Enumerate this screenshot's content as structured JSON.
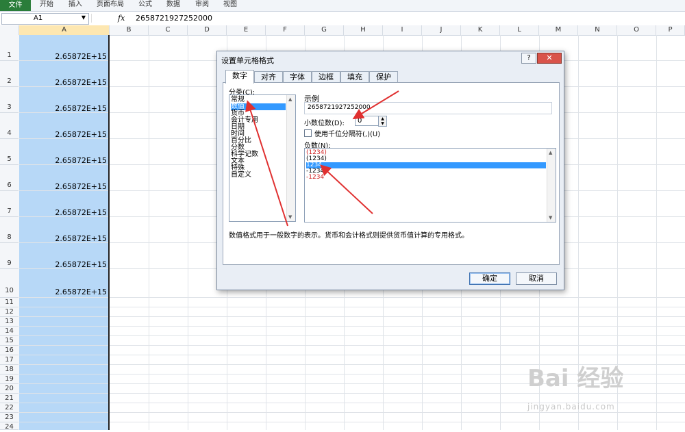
{
  "ribbon": {
    "file_tab": "文件",
    "tabs": [
      "开始",
      "插入",
      "页面布局",
      "公式",
      "数据",
      "审阅",
      "视图"
    ]
  },
  "formula_bar": {
    "name_box": "A1",
    "fx": "fx",
    "value": "2658721927252000"
  },
  "grid": {
    "columns": [
      "A",
      "B",
      "C",
      "D",
      "E",
      "F",
      "G",
      "H",
      "I",
      "J",
      "K",
      "L",
      "M",
      "N",
      "O",
      "P"
    ],
    "rows": [
      "1",
      "2",
      "3",
      "4",
      "5",
      "6",
      "7",
      "8",
      "9",
      "10",
      "11",
      "12",
      "13",
      "14",
      "15",
      "16",
      "17",
      "18",
      "19",
      "20",
      "21",
      "22",
      "23",
      "24"
    ],
    "col_a_values": [
      "2.65872E+15",
      "2.65872E+15",
      "2.65872E+15",
      "2.65872E+15",
      "2.65872E+15",
      "2.65872E+15",
      "2.65872E+15",
      "2.65872E+15",
      "2.65872E+15",
      "2.65872E+15"
    ]
  },
  "dialog": {
    "title": "设置单元格格式",
    "help": "?",
    "close": "✕",
    "tabs": [
      "数字",
      "对齐",
      "字体",
      "边框",
      "填充",
      "保护"
    ],
    "active_tab": "数字",
    "category_label": "分类(C):",
    "categories": [
      "常规",
      "数值",
      "货币",
      "会计专用",
      "日期",
      "时间",
      "百分比",
      "分数",
      "科学记数",
      "文本",
      "特殊",
      "自定义"
    ],
    "selected_category": "数值",
    "sample_label": "示例",
    "sample_value": "2658721927252000",
    "decimal_label": "小数位数(D):",
    "decimal_value": "0",
    "thousands_label": "使用千位分隔符(,)(U)",
    "negative_label": "负数(N):",
    "negative_options": [
      "(1234)",
      "(1234)",
      "1234",
      "-1234",
      "-1234"
    ],
    "negative_colors": [
      "#d02020",
      "#000000",
      "#ffffff",
      "#000000",
      "#d02020"
    ],
    "selected_negative_index": 2,
    "description": "数值格式用于一般数字的表示。货币和会计格式则提供货币值计算的专用格式。",
    "ok": "确定",
    "cancel": "取消"
  },
  "watermark": {
    "main": "Bai 经验",
    "url": "jingyan.baidu.com"
  },
  "colors": {
    "selection_blue": "#b7d8f7",
    "list_highlight": "#3399ff",
    "arrow_red": "#e03030",
    "excel_green": "#2a7d3a"
  }
}
